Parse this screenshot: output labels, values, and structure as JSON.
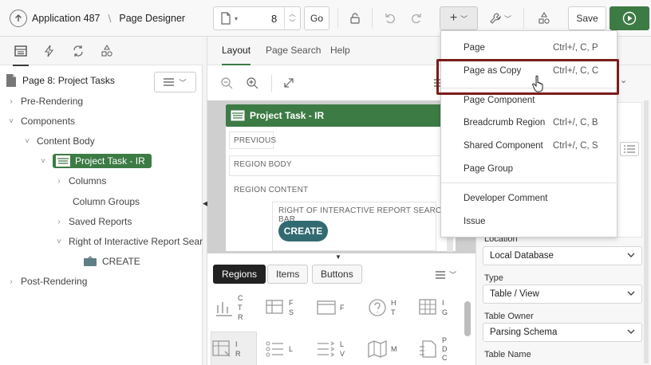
{
  "header": {
    "app_name": "Application 487",
    "page_designer": "Page Designer",
    "page_number": "8",
    "go_label": "Go",
    "save_label": "Save"
  },
  "left": {
    "page_title": "Page 8: Project Tasks",
    "tree": {
      "pre_rendering": "Pre-Rendering",
      "components": "Components",
      "content_body": "Content Body",
      "project_task_ir": "Project Task - IR",
      "columns": "Columns",
      "column_groups": "Column Groups",
      "saved_reports": "Saved Reports",
      "right_of_ir_search": "Right of Interactive Report Search",
      "create": "CREATE",
      "post_rendering": "Post-Rendering"
    }
  },
  "center": {
    "tabs": [
      "Layout",
      "Page Search",
      "Help"
    ],
    "region_title": "Project Task - IR",
    "slots": {
      "previous": "PREVIOUS",
      "region_body": "REGION BODY",
      "region_content": "REGION CONTENT",
      "right_of_ir": "RIGHT OF INTERACTIVE REPORT SEARCH BAR"
    },
    "create_button": "CREATE",
    "gallery_tabs": [
      "Regions",
      "Items",
      "Buttons"
    ],
    "gallery_items": [
      {
        "icon": "chart-icon",
        "label": "C\nT\nR"
      },
      {
        "icon": "form-icon",
        "label": "F\nS"
      },
      {
        "icon": "frame-icon",
        "label": "F"
      },
      {
        "icon": "help-icon",
        "label": "H\nT"
      },
      {
        "icon": "grid-icon",
        "label": "I\nG"
      },
      {
        "icon": "ir-icon",
        "label": "I\nR"
      },
      {
        "icon": "list-icon",
        "label": "L"
      },
      {
        "icon": "list-view-icon",
        "label": "L\nV"
      },
      {
        "icon": "map-icon",
        "label": "M"
      },
      {
        "icon": "pdf-icon",
        "label": "P\nD\nC"
      }
    ]
  },
  "menu": {
    "items": [
      {
        "label": "Page",
        "shortcut": "Ctrl+/, C, P"
      },
      {
        "label": "Page as Copy",
        "shortcut": "Ctrl+/, C, C"
      },
      {
        "label": "Page Component",
        "shortcut": ""
      },
      {
        "label": "Breadcrumb Region",
        "shortcut": "Ctrl+/, C, B"
      },
      {
        "label": "Shared Component",
        "shortcut": "Ctrl+/, C, S"
      },
      {
        "label": "Page Group",
        "shortcut": ""
      },
      {
        "label": "Developer Comment",
        "shortcut": ""
      },
      {
        "label": "Issue",
        "shortcut": ""
      }
    ]
  },
  "right": {
    "location_label": "Location",
    "location_value": "Local Database",
    "type_label": "Type",
    "type_value": "Table / View",
    "table_owner_label": "Table Owner",
    "table_owner_value": "Parsing Schema",
    "table_name_label": "Table Name"
  },
  "colors": {
    "accent_green": "#3d7b45",
    "create_teal": "#326a72",
    "highlight_red": "#7b1c1c",
    "run_button": "#3d7b45"
  }
}
